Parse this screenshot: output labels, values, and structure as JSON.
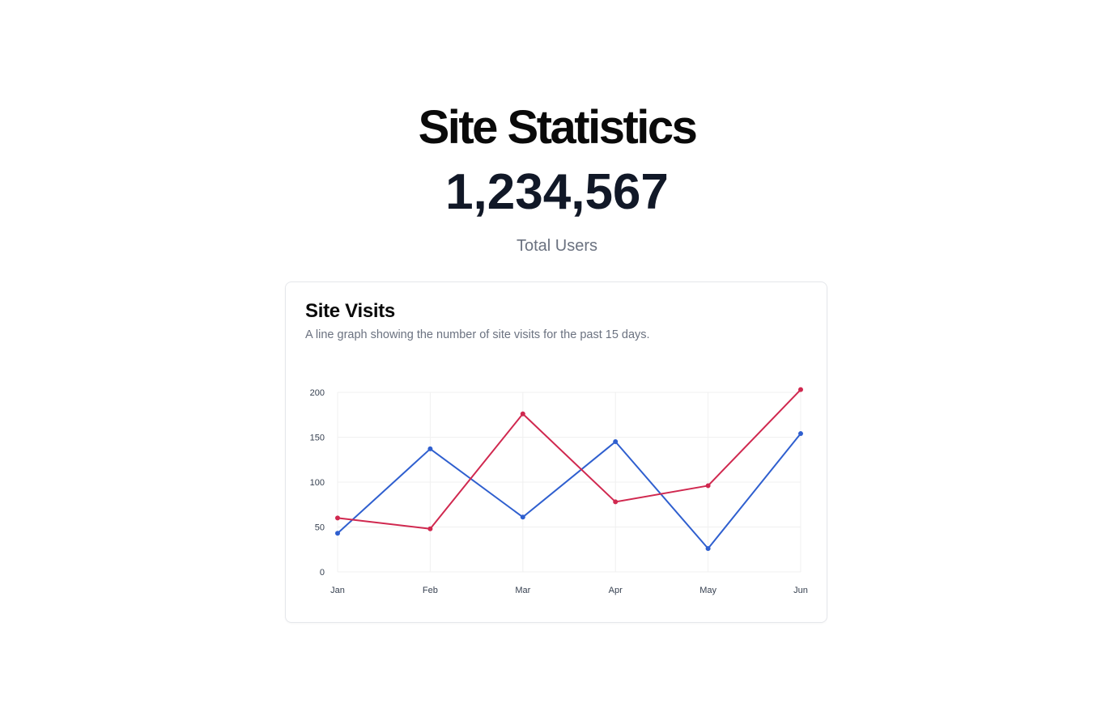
{
  "hero": {
    "title": "Site Statistics",
    "total": "1,234,567",
    "caption": "Total Users"
  },
  "card": {
    "title": "Site Visits",
    "description": "A line graph showing the number of site visits for the past 15 days."
  },
  "chart_data": {
    "type": "line",
    "categories": [
      "Jan",
      "Feb",
      "Mar",
      "Apr",
      "May",
      "Jun"
    ],
    "series": [
      {
        "color": "#2f5fcf",
        "values": [
          43,
          137,
          61,
          145,
          26,
          154
        ]
      },
      {
        "color": "#d0284f",
        "values": [
          60,
          48,
          176,
          78,
          96,
          203
        ]
      }
    ],
    "ylim": [
      0,
      200
    ],
    "yticks": [
      0,
      50,
      100,
      150,
      200
    ],
    "grid": true,
    "legend": "none"
  }
}
